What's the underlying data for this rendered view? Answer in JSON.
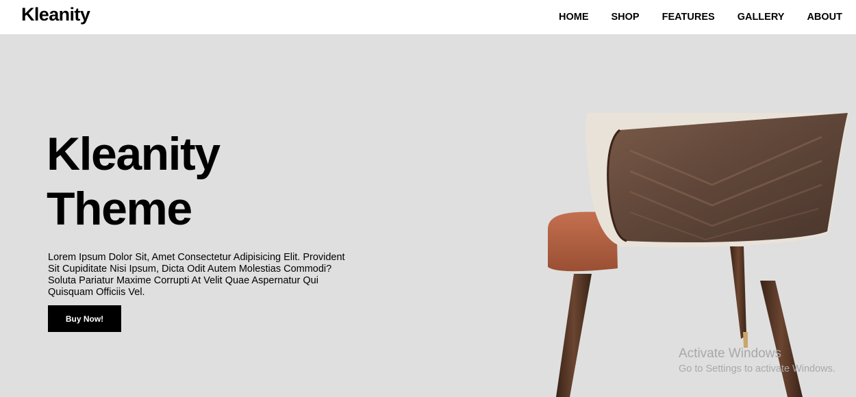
{
  "header": {
    "logo": "Kleanity",
    "nav": [
      "HOME",
      "SHOP",
      "FEATURES",
      "GALLERY",
      "ABOUT"
    ]
  },
  "hero": {
    "title_line1": "Kleanity",
    "title_line2": "Theme",
    "description": "Lorem Ipsum Dolor Sit, Amet Consectetur Adipisicing Elit. Provident Sit Cupiditate Nisi Ipsum, Dicta Odit Autem Molestias Commodi? Soluta Pariatur Maxime Corrupti At Velit Quae Aspernatur Qui Quisquam Officiis Vel.",
    "button_label": "Buy Now!",
    "background_color": "#dfdfdf"
  },
  "watermark": {
    "title": "Activate Windows",
    "subtitle": "Go to Settings to activate Windows."
  }
}
